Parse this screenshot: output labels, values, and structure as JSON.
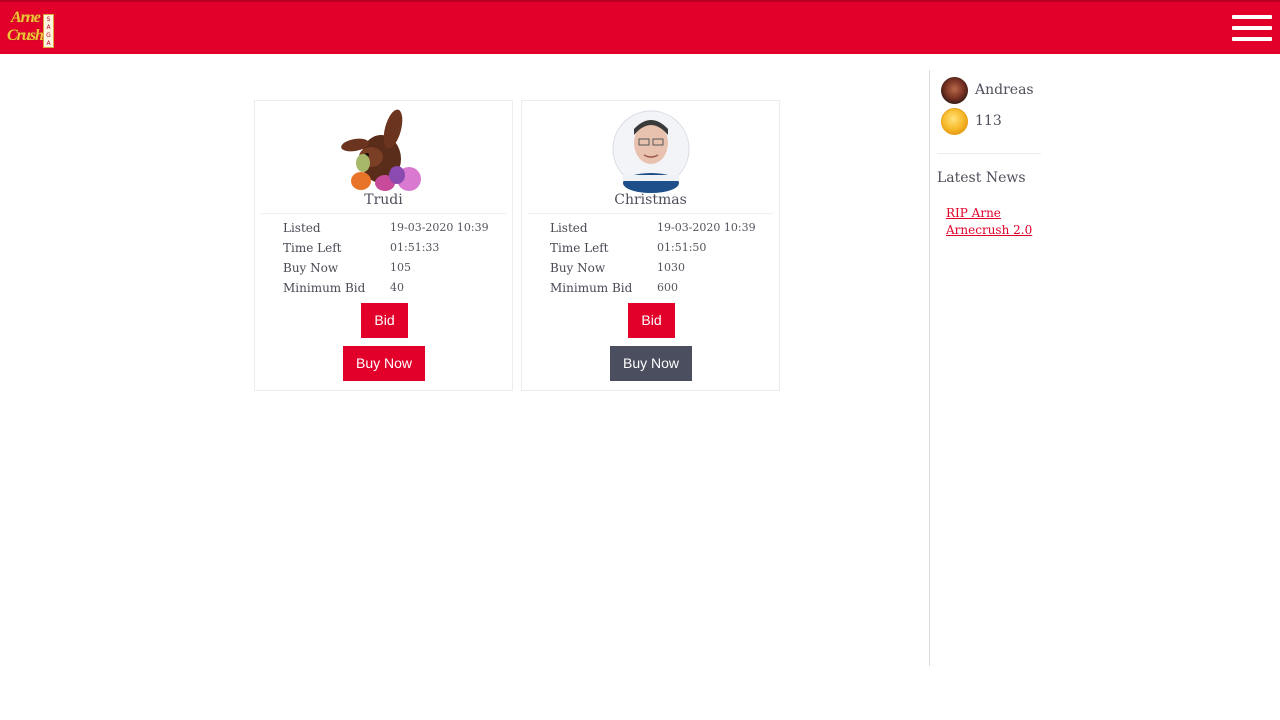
{
  "header": {
    "logo_text_line1": "Arne",
    "logo_text_line2": "Crush",
    "logo_tag": "SAGA",
    "brand_color": "#e2002b",
    "menu_icon": "hamburger-menu-icon"
  },
  "listings": [
    {
      "name": "Trudi",
      "image_icon": "easter-bunny-image",
      "fields": [
        {
          "label": "Listed",
          "value": "19-03-2020 10:39"
        },
        {
          "label": "Time Left",
          "value": "01:51:33"
        },
        {
          "label": "Buy Now",
          "value": "105"
        },
        {
          "label": "Minimum Bid",
          "value": "40"
        }
      ],
      "bid_label": "Bid",
      "buy_label": "Buy Now"
    },
    {
      "name": "Christmas",
      "image_icon": "snowglobe-portrait-image",
      "fields": [
        {
          "label": "Listed",
          "value": "19-03-2020 10:39"
        },
        {
          "label": "Time Left",
          "value": "01:51:50"
        },
        {
          "label": "Buy Now",
          "value": "1030"
        },
        {
          "label": "Minimum Bid",
          "value": "600"
        }
      ],
      "bid_label": "Bid",
      "buy_label": "Buy Now"
    }
  ],
  "sidebar": {
    "username": "Andreas",
    "coins": "113",
    "latest_news_title": "Latest News",
    "news_links": [
      "RIP Arne Arnecrush 2.0"
    ]
  },
  "colors": {
    "accent": "#e2002b",
    "dark_button": "#4b4e5f",
    "coin": "#f7b92a"
  }
}
